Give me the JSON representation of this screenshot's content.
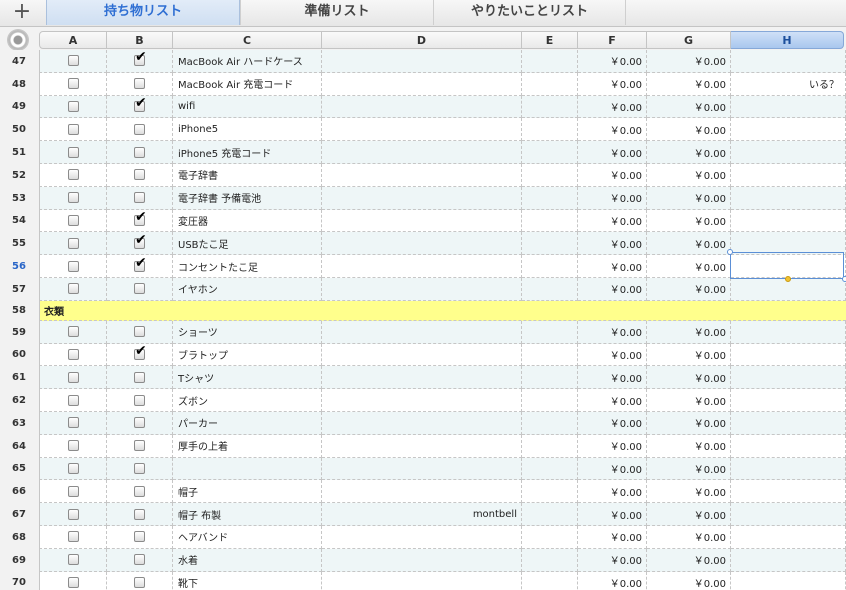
{
  "toolbar": {
    "add_label": "+"
  },
  "tabs": [
    {
      "label": "持ち物リスト",
      "active": true
    },
    {
      "label": "準備リスト",
      "active": false
    },
    {
      "label": "やりたいことリスト",
      "active": false
    }
  ],
  "columns": [
    "A",
    "B",
    "C",
    "D",
    "E",
    "F",
    "G",
    "H"
  ],
  "selected_column": "H",
  "selected_cell": "H56",
  "rows": [
    {
      "num": "47",
      "a": false,
      "b": true,
      "c": "MacBook Air ハードケース",
      "d": "",
      "f": "￥0.00",
      "g": "￥0.00",
      "h": ""
    },
    {
      "num": "48",
      "a": false,
      "b": false,
      "c": "MacBook Air 充電コード",
      "d": "",
      "f": "￥0.00",
      "g": "￥0.00",
      "h": "いる？"
    },
    {
      "num": "49",
      "a": false,
      "b": true,
      "c": "wifi",
      "d": "",
      "f": "￥0.00",
      "g": "￥0.00",
      "h": ""
    },
    {
      "num": "50",
      "a": false,
      "b": false,
      "c": "iPhone5",
      "d": "",
      "f": "￥0.00",
      "g": "￥0.00",
      "h": ""
    },
    {
      "num": "51",
      "a": false,
      "b": false,
      "c": "iPhone5 充電コード",
      "d": "",
      "f": "￥0.00",
      "g": "￥0.00",
      "h": ""
    },
    {
      "num": "52",
      "a": false,
      "b": false,
      "c": "電子辞書",
      "d": "",
      "f": "￥0.00",
      "g": "￥0.00",
      "h": ""
    },
    {
      "num": "53",
      "a": false,
      "b": false,
      "c": "電子辞書 予備電池",
      "d": "",
      "f": "￥0.00",
      "g": "￥0.00",
      "h": ""
    },
    {
      "num": "54",
      "a": false,
      "b": true,
      "c": "変圧器",
      "d": "",
      "f": "￥0.00",
      "g": "￥0.00",
      "h": ""
    },
    {
      "num": "55",
      "a": false,
      "b": true,
      "c": "USBたこ足",
      "d": "",
      "f": "￥0.00",
      "g": "￥0.00",
      "h": ""
    },
    {
      "num": "56",
      "a": false,
      "b": true,
      "c": "コンセントたこ足",
      "d": "",
      "f": "￥0.00",
      "g": "￥0.00",
      "h": ""
    },
    {
      "num": "57",
      "a": false,
      "b": false,
      "c": "イヤホン",
      "d": "",
      "f": "￥0.00",
      "g": "￥0.00",
      "h": ""
    },
    {
      "num": "58",
      "section": "衣類"
    },
    {
      "num": "59",
      "a": false,
      "b": false,
      "c": "ショーツ",
      "d": "",
      "f": "￥0.00",
      "g": "￥0.00",
      "h": ""
    },
    {
      "num": "60",
      "a": false,
      "b": true,
      "c": "ブラトップ",
      "d": "",
      "f": "￥0.00",
      "g": "￥0.00",
      "h": ""
    },
    {
      "num": "61",
      "a": false,
      "b": false,
      "c": "Tシャツ",
      "d": "",
      "f": "￥0.00",
      "g": "￥0.00",
      "h": ""
    },
    {
      "num": "62",
      "a": false,
      "b": false,
      "c": "ズボン",
      "d": "",
      "f": "￥0.00",
      "g": "￥0.00",
      "h": ""
    },
    {
      "num": "63",
      "a": false,
      "b": false,
      "c": "パーカー",
      "d": "",
      "f": "￥0.00",
      "g": "￥0.00",
      "h": ""
    },
    {
      "num": "64",
      "a": false,
      "b": false,
      "c": "厚手の上着",
      "d": "",
      "f": "￥0.00",
      "g": "￥0.00",
      "h": ""
    },
    {
      "num": "65",
      "a": false,
      "b": false,
      "c": "",
      "d": "",
      "f": "￥0.00",
      "g": "￥0.00",
      "h": ""
    },
    {
      "num": "66",
      "a": false,
      "b": false,
      "c": "帽子",
      "d": "",
      "f": "￥0.00",
      "g": "￥0.00",
      "h": ""
    },
    {
      "num": "67",
      "a": false,
      "b": false,
      "c": "帽子 布製",
      "d": "montbell",
      "f": "￥0.00",
      "g": "￥0.00",
      "h": ""
    },
    {
      "num": "68",
      "a": false,
      "b": false,
      "c": "ヘアバンド",
      "d": "",
      "f": "￥0.00",
      "g": "￥0.00",
      "h": ""
    },
    {
      "num": "69",
      "a": false,
      "b": false,
      "c": "水着",
      "d": "",
      "f": "￥0.00",
      "g": "￥0.00",
      "h": ""
    },
    {
      "num": "70",
      "a": false,
      "b": false,
      "c": "靴下",
      "d": "",
      "f": "￥0.00",
      "g": "￥0.00",
      "h": ""
    }
  ]
}
